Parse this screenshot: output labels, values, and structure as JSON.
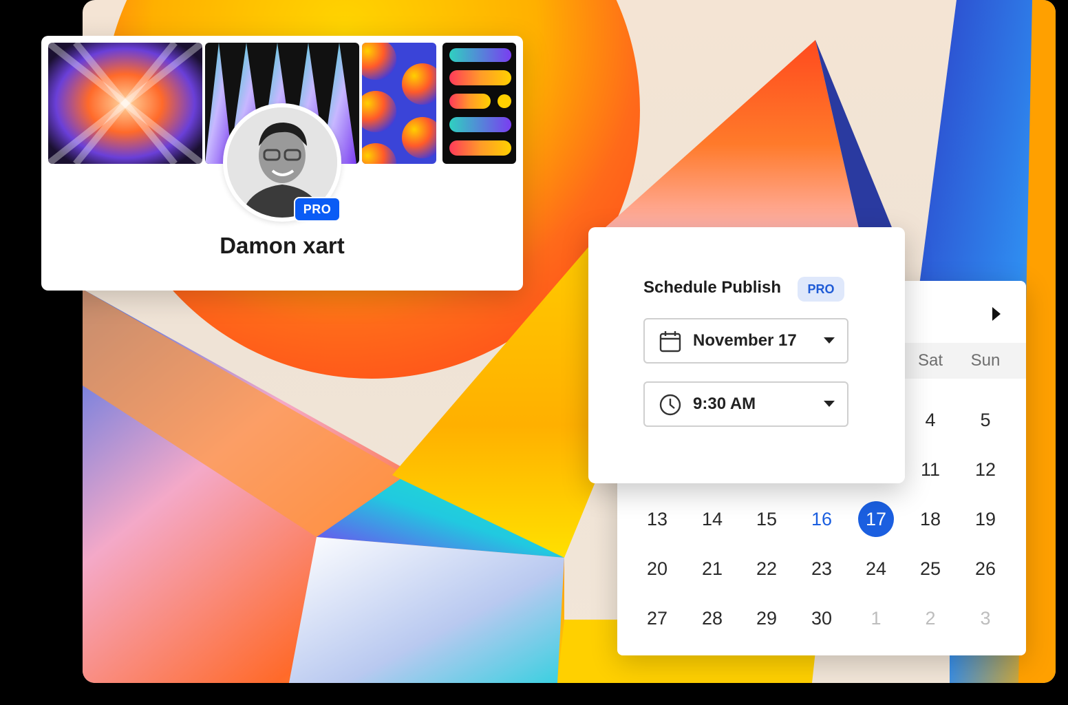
{
  "profile": {
    "name": "Damon xart",
    "badge": "PRO"
  },
  "schedule": {
    "title": "Schedule Publish",
    "badge": "PRO",
    "date_value": "November 17",
    "time_value": "9:30 AM",
    "date_icon": "calendar-icon",
    "time_icon": "clock-icon",
    "dropdown_icon": "caret-down-icon"
  },
  "calendar": {
    "next_icon": "caret-right-icon",
    "weekdays_visible": [
      "Sat",
      "Sun"
    ],
    "weeks": [
      [
        "",
        "",
        "",
        "",
        "",
        "4",
        "5"
      ],
      [
        "",
        "",
        "",
        "",
        "",
        "11",
        "12"
      ],
      [
        "13",
        "14",
        "15",
        "16",
        "17",
        "18",
        "19"
      ],
      [
        "20",
        "21",
        "22",
        "23",
        "24",
        "25",
        "26"
      ],
      [
        "27",
        "28",
        "29",
        "30",
        "1",
        "2",
        "3"
      ]
    ],
    "today": "16",
    "selected": "17",
    "accent_color": "#1b5fe0"
  }
}
